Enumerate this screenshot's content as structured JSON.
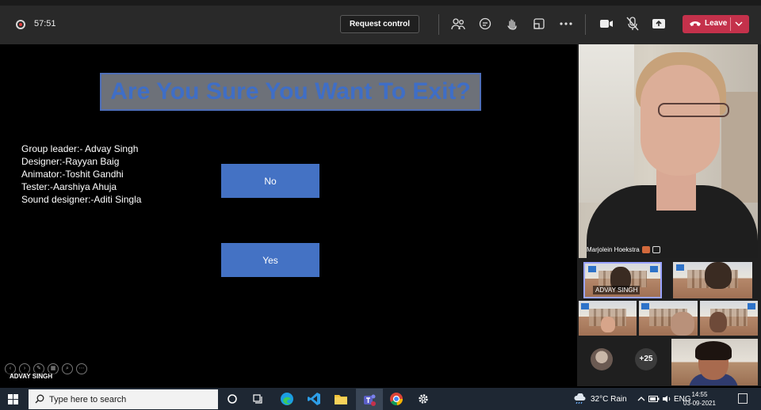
{
  "meeting": {
    "timer": "57:51",
    "request_control_label": "Request control",
    "leave_label": "Leave",
    "colors": {
      "leave": "#c4314b",
      "toolbar": "#292929"
    },
    "toolbar_icons": [
      "people-icon",
      "chat-icon",
      "raise-hand-icon",
      "rooms-icon",
      "more-icon",
      "camera-icon",
      "mic-off-icon",
      "share-icon"
    ]
  },
  "slide": {
    "title": "Are You Sure You Want To Exit?",
    "credits": [
      "Group leader:- Advay Singh",
      "Designer:-Rayyan Baig",
      "Animator:-Toshit Gandhi",
      "Tester:-Aarshiya Ahuja",
      "Sound designer:-Aditi Singla"
    ],
    "no_label": "No",
    "yes_label": "Yes",
    "colors": {
      "title_text": "#3f6ec6",
      "button": "#4472c4"
    }
  },
  "presenter_name": "ADVAY SINGH",
  "participants": {
    "main_speaker": "Marjolein Hoekstra",
    "selected_tile_name": "ADVAY SINGH",
    "more_count": "+25"
  },
  "taskbar": {
    "search_placeholder": "Type here to search",
    "weather": "32°C  Rain",
    "language": "ENG",
    "time": "14:55",
    "date": "03-09-2021"
  }
}
